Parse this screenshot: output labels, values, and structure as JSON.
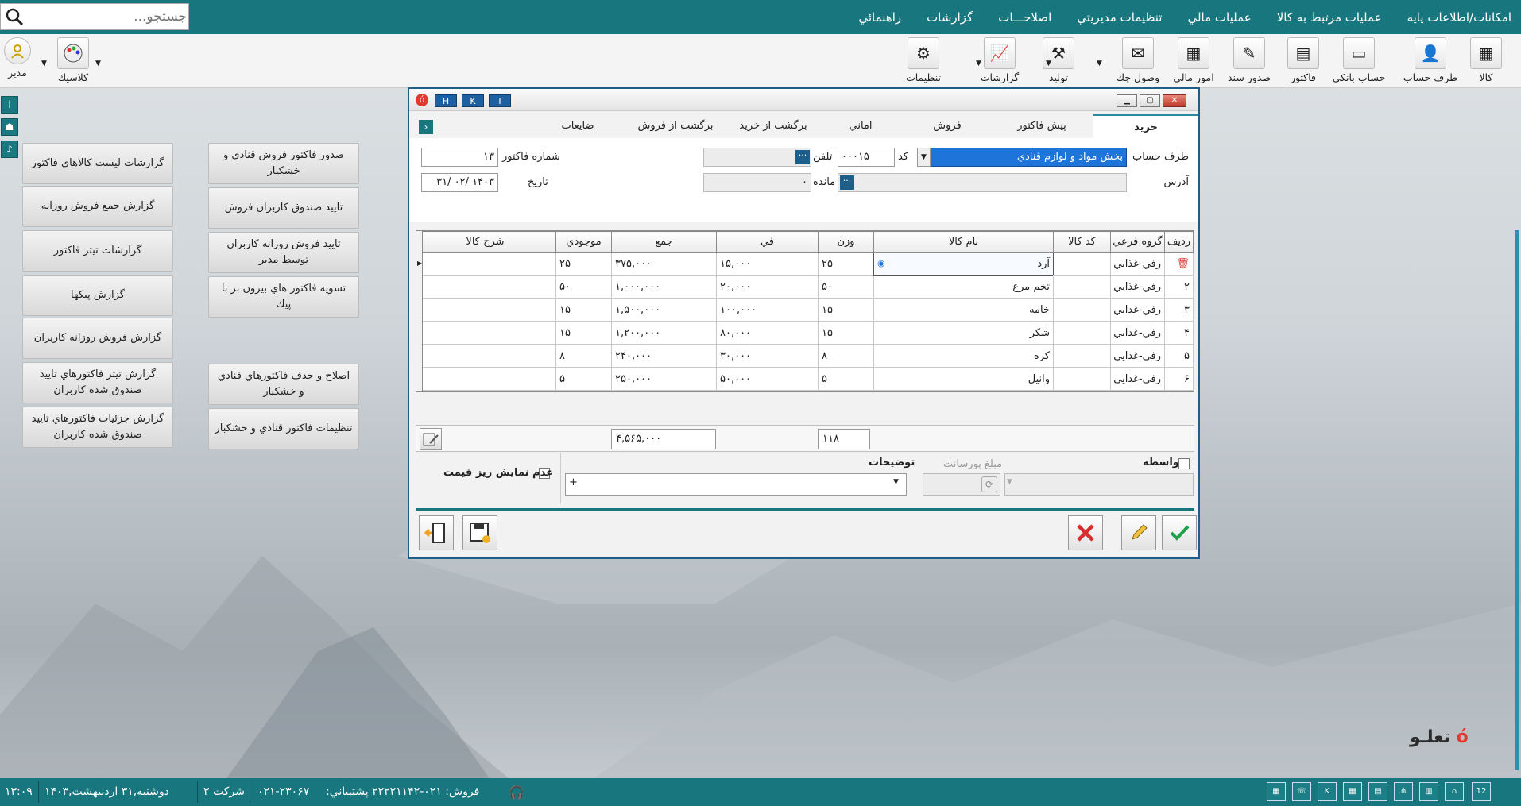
{
  "menu": {
    "items": [
      "امكانات/اطلاعات پايه",
      "عمليات مرتبط به كالا",
      "عمليات مالي",
      "تنظيمات مديريتي",
      "اصلاحـــات",
      "گزارشات",
      "راهنمائي"
    ]
  },
  "search": {
    "placeholder": "جستجو..."
  },
  "toolbar": {
    "items": [
      {
        "label": "كالا",
        "icon": "box-icon"
      },
      {
        "label": "طرف حساب",
        "icon": "person-icon"
      },
      {
        "label": "حساب بانكي",
        "icon": "bank-card-icon"
      },
      {
        "label": "فاكتور",
        "icon": "register-icon"
      },
      {
        "label": "صدور سند",
        "icon": "document-edit-icon"
      },
      {
        "label": "امور مالي",
        "icon": "calculator-icon"
      },
      {
        "label": "وصول چك",
        "icon": "envelope-icon"
      },
      {
        "label": "توليد",
        "icon": "production-icon"
      },
      {
        "label": "گزارشات",
        "icon": "chart-icon"
      },
      {
        "label": "تنظيمات",
        "icon": "gear-icon"
      }
    ],
    "theme_label": "كلاسيك",
    "user_label": "مدير"
  },
  "report_buttons": {
    "col_left": [
      "گزارشات ليست كالاهاي فاكتور",
      "گزارش جمع فروش روزانه",
      "گزارشات تيتر فاكتور",
      "گزارش پيكها",
      "گزارش فروش روزانه كاربران",
      "گزارش تيتر فاكتورهاي تاييد صندوق شده كاربران",
      "گزارش جزئيات فاكتورهاي تاييد صندوق شده كاربران"
    ],
    "col_right": [
      "صدور فاكتور فروش قنادي و خشكبار",
      "تاييد صندوق كاربران فروش",
      "تاييد فروش روزانه كاربران توسط مدير",
      "تسويه فاكتور هاي بيرون بر با پيك",
      "اصلاح و حذف فاكتورهاي قنادي و خشكبار",
      "تنظيمات فاكتور قنادي و خشكبار"
    ]
  },
  "window": {
    "badges": [
      "H",
      "K",
      "T"
    ],
    "tabs": [
      "خريد",
      "پيش فاكتور",
      "فروش",
      "اماني",
      "برگشت از خريد",
      "برگشت از فروش",
      "ضايعات"
    ],
    "form": {
      "account_label": "طرف حساب",
      "account_value": "بخش مواد و لوازم قنادي",
      "code_label": "كد",
      "code_value": "۰۰۰۱۵",
      "phone_label": "تلفن",
      "phone_value": "",
      "invoice_no_label": "شماره فاكتور",
      "invoice_no_value": "۱۳",
      "address_label": "آدرس",
      "address_value": "",
      "balance_label": "مانده",
      "balance_value": "۰",
      "date_label": "تاريخ",
      "date_value": "۱۴۰۳ /۰۲ /۳۱"
    },
    "grid": {
      "headers": [
        "رديف",
        "گروه فرعي",
        "كد كالا",
        "نام كالا",
        "وزن",
        "في",
        "جمع",
        "موجودي",
        "شرح كالا"
      ],
      "rows": [
        {
          "row": "",
          "group": "رفي-غذايي",
          "code": "",
          "name": "آرد",
          "weight": "۲۵",
          "price": "۱۵,۰۰۰",
          "total": "۳۷۵,۰۰۰",
          "stock": "۲۵",
          "desc": ""
        },
        {
          "row": "۲",
          "group": "رفي-غذايي",
          "code": "",
          "name": "تخم مرغ",
          "weight": "۵۰",
          "price": "۲۰,۰۰۰",
          "total": "۱,۰۰۰,۰۰۰",
          "stock": "۵۰",
          "desc": ""
        },
        {
          "row": "۳",
          "group": "رفي-غذايي",
          "code": "",
          "name": "خامه",
          "weight": "۱۵",
          "price": "۱۰۰,۰۰۰",
          "total": "۱,۵۰۰,۰۰۰",
          "stock": "۱۵",
          "desc": ""
        },
        {
          "row": "۴",
          "group": "رفي-غذايي",
          "code": "",
          "name": "شكر",
          "weight": "۱۵",
          "price": "۸۰,۰۰۰",
          "total": "۱,۲۰۰,۰۰۰",
          "stock": "۱۵",
          "desc": ""
        },
        {
          "row": "۵",
          "group": "رفي-غذايي",
          "code": "",
          "name": "كره",
          "weight": "۸",
          "price": "۳۰,۰۰۰",
          "total": "۲۴۰,۰۰۰",
          "stock": "۸",
          "desc": ""
        },
        {
          "row": "۶",
          "group": "رفي-غذايي",
          "code": "",
          "name": "وانيل",
          "weight": "۵",
          "price": "۵۰,۰۰۰",
          "total": "۲۵۰,۰۰۰",
          "stock": "۵",
          "desc": ""
        }
      ],
      "sum_weight": "۱۱۸",
      "sum_total": "۴,۵۶۵,۰۰۰"
    },
    "bottom": {
      "broker_label": "واسطه",
      "commission_label": "مبلغ پورسانت",
      "notes_label": "توضيحات",
      "notes_value": "+",
      "hide_price_label": "عدم نمايش ريز قيمت"
    }
  },
  "status": {
    "datetime": "دوشنبه,۳۱ ارديبهشت,۱۴۰۳",
    "time": "۱۳:۰۹",
    "company": "شركت ۲",
    "support_phone": "۰۲۱-۲۳۰۶۷",
    "sales_text": "فروش: ۰۲۱-۲۲۲۲۱۱۴۲ پشتيباني:",
    "calendar_day": "12"
  },
  "brand": {
    "logo_text": "تعلـو"
  },
  "colors": {
    "accent": "#17767e",
    "window_border": "#1e5f8a",
    "selected_field": "#1e74d8"
  }
}
